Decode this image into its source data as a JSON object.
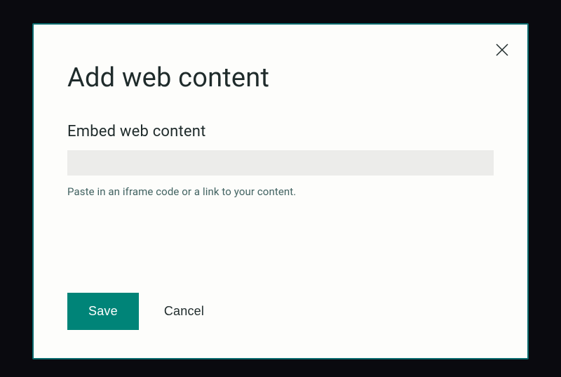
{
  "modal": {
    "title": "Add web content",
    "close_aria": "Close",
    "section_label": "Embed web content",
    "input_value": "",
    "input_placeholder": "",
    "helper_text": "Paste in an iframe code or a link to your content.",
    "save_label": "Save",
    "cancel_label": "Cancel"
  },
  "colors": {
    "accent": "#008478",
    "modal_border": "#0a6b6e",
    "text_primary": "#1f2b2b",
    "text_helper": "#426362",
    "input_bg": "#ececea",
    "modal_bg": "#fdfdfb",
    "page_bg": "#0a0a0f"
  }
}
